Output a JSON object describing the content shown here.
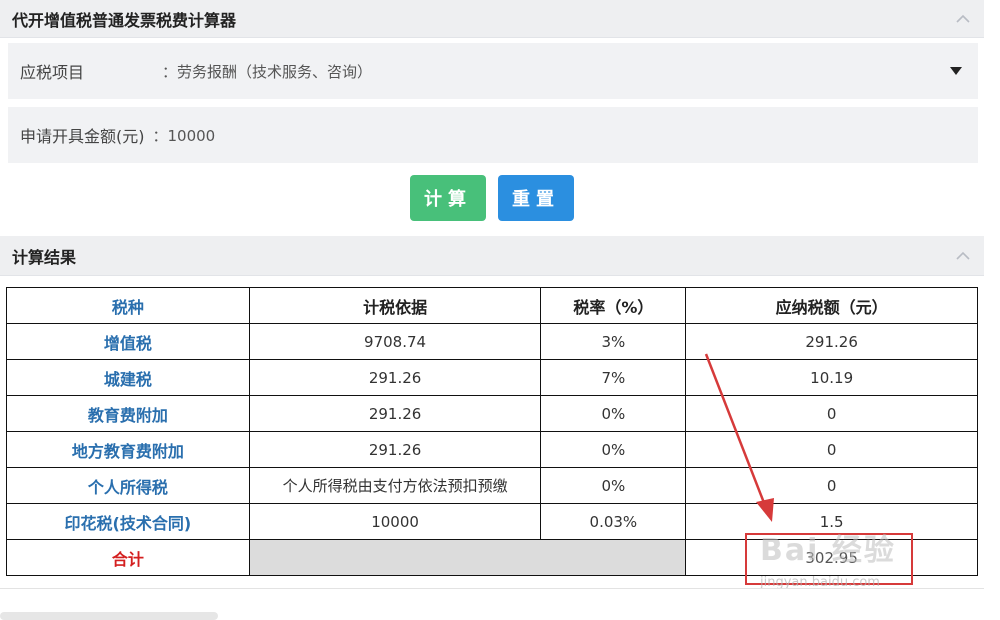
{
  "calculator": {
    "title": "代开增值税普通发票税费计算器",
    "fields": {
      "tax_item_label": "应税项目",
      "tax_item_value": "：劳务报酬（技术服务、咨询）",
      "amount_label": "申请开具金额(元)",
      "amount_value": "：10000"
    },
    "buttons": {
      "calc": "计算",
      "reset": "重置"
    }
  },
  "results": {
    "title": "计算结果",
    "headers": [
      "税种",
      "计税依据",
      "税率（%）",
      "应纳税额（元）"
    ],
    "rows": [
      {
        "name": "增值税",
        "basis": "9708.74",
        "rate": "3%",
        "amount": "291.26"
      },
      {
        "name": "城建税",
        "basis": "291.26",
        "rate": "7%",
        "amount": "10.19"
      },
      {
        "name": "教育费附加",
        "basis": "291.26",
        "rate": "0%",
        "amount": "0"
      },
      {
        "name": "地方教育费附加",
        "basis": "291.26",
        "rate": "0%",
        "amount": "0"
      },
      {
        "name": "个人所得税",
        "basis": "个人所得税由支付方依法预扣预缴",
        "rate": "0%",
        "amount": "0"
      },
      {
        "name": "印花税(技术合同)",
        "basis": "10000",
        "rate": "0.03%",
        "amount": "1.5"
      }
    ],
    "total_label": "合计",
    "total_value": "302.95"
  },
  "watermark": {
    "main": "Bai 经验",
    "sub": "jingyan.baidu.com"
  },
  "colors": {
    "calc_button": "#48c07a",
    "reset_button": "#2b8fe0",
    "annotation": "#d63a3a",
    "tax_name": "#2a6fae",
    "total_label": "#d42020"
  }
}
